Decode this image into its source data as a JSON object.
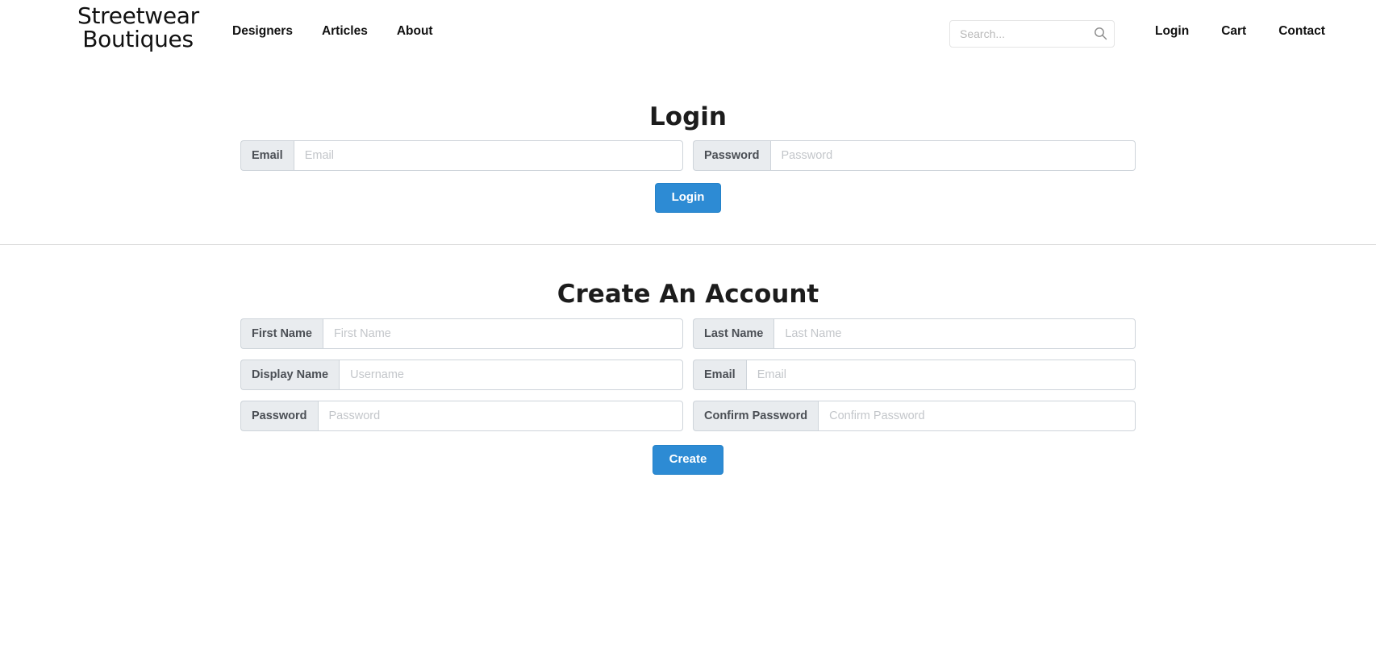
{
  "navbar": {
    "brand_line1": "Streetwear",
    "brand_line2": "Boutiques",
    "links": [
      {
        "label": "Designers"
      },
      {
        "label": "Articles"
      },
      {
        "label": "About"
      }
    ],
    "search": {
      "placeholder": "Search...",
      "value": "",
      "icon": "search-icon"
    },
    "right_links": [
      {
        "label": "Login"
      },
      {
        "label": "Cart"
      },
      {
        "label": "Contact"
      }
    ]
  },
  "login_section": {
    "title": "Login",
    "fields": [
      {
        "label": "Email",
        "placeholder": "Email",
        "value": ""
      },
      {
        "label": "Password",
        "placeholder": "Password",
        "value": ""
      }
    ],
    "submit_label": "Login"
  },
  "register_section": {
    "title": "Create An Account",
    "fields": [
      {
        "label": "First Name",
        "placeholder": "First Name",
        "value": ""
      },
      {
        "label": "Last Name",
        "placeholder": "Last Name",
        "value": ""
      },
      {
        "label": "Display Name",
        "placeholder": "Username",
        "value": ""
      },
      {
        "label": "Email",
        "placeholder": "Email",
        "value": ""
      },
      {
        "label": "Password",
        "placeholder": "Password",
        "value": ""
      },
      {
        "label": "Confirm Password",
        "placeholder": "Confirm Password",
        "value": ""
      }
    ],
    "submit_label": "Create"
  },
  "colors": {
    "button_blue": "#2d8bd4",
    "label_gray": "#e9ecef",
    "border_gray": "#ced4da",
    "divider_gray": "#d8d8d8"
  }
}
